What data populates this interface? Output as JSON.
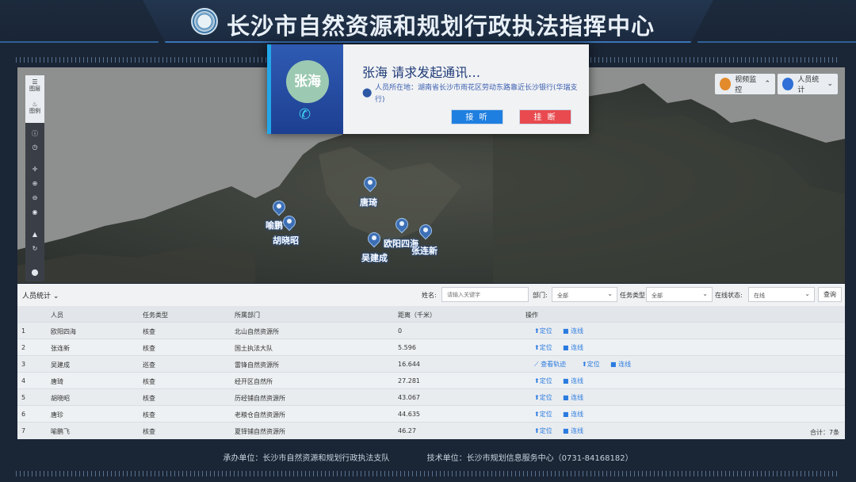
{
  "header": {
    "title": "长沙市自然资源和规划行政执法指挥中心"
  },
  "map": {
    "toolbar": {
      "layers_label": "图层",
      "legend_label": "图例"
    },
    "controls": {
      "video_label": "视频监控",
      "people_label": "人员统计"
    },
    "markers": [
      {
        "label": "唐琦"
      },
      {
        "label": "喻鹏飞"
      },
      {
        "label": "胡晓昭"
      },
      {
        "label": "欧阳四海"
      },
      {
        "label": "张连新"
      },
      {
        "label": "吴建成"
      }
    ]
  },
  "call_dialog": {
    "avatar_text": "张海",
    "title": "张海  请求发起通讯…",
    "location": "人员所在地：湖南省长沙市雨花区劳动东路靠近长沙银行(华瑞支行)",
    "answer_label": "接 听",
    "hangup_label": "挂 断"
  },
  "stats": {
    "title": "人员统计",
    "filters": {
      "name_label": "姓名:",
      "name_placeholder": "请输入关键字",
      "dept_label": "部门:",
      "dept_value": "全部",
      "task_label": "任务类型",
      "task_value": "全部",
      "online_label": "在线状态:",
      "online_value": "在线",
      "query_label": "查询"
    },
    "columns": [
      "人员",
      "任务类型",
      "所属部门",
      "距离（千米）",
      "操作"
    ],
    "rows": [
      {
        "idx": "1",
        "name": "欧阳四海",
        "task": "核查",
        "dept": "北山自然资源所",
        "dist": "0",
        "track": ""
      },
      {
        "idx": "2",
        "name": "张连新",
        "task": "核查",
        "dept": "国土执法大队",
        "dist": "5.596",
        "track": ""
      },
      {
        "idx": "3",
        "name": "吴建成",
        "task": "巡查",
        "dept": "雷锋自然资源所",
        "dist": "16.644",
        "track": "查看轨迹"
      },
      {
        "idx": "4",
        "name": "唐琦",
        "task": "核查",
        "dept": "经开区自然所",
        "dist": "27.281",
        "track": ""
      },
      {
        "idx": "5",
        "name": "胡晓昭",
        "task": "核查",
        "dept": "历经铺自然资源所",
        "dist": "43.067",
        "track": ""
      },
      {
        "idx": "6",
        "name": "唐珍",
        "task": "核查",
        "dept": "老粮仓自然资源所",
        "dist": "44.635",
        "track": ""
      },
      {
        "idx": "7",
        "name": "喻鹏飞",
        "task": "核查",
        "dept": "夏铎铺自然资源所",
        "dist": "46.27",
        "track": ""
      }
    ],
    "locate_label": "定位",
    "connect_label": "连线",
    "total": "合计：7条"
  },
  "footer": {
    "host": "承办单位：长沙市自然资源和规划行政执法支队",
    "tech": "技术单位：长沙市规划信息服务中心（0731-84168182）"
  }
}
